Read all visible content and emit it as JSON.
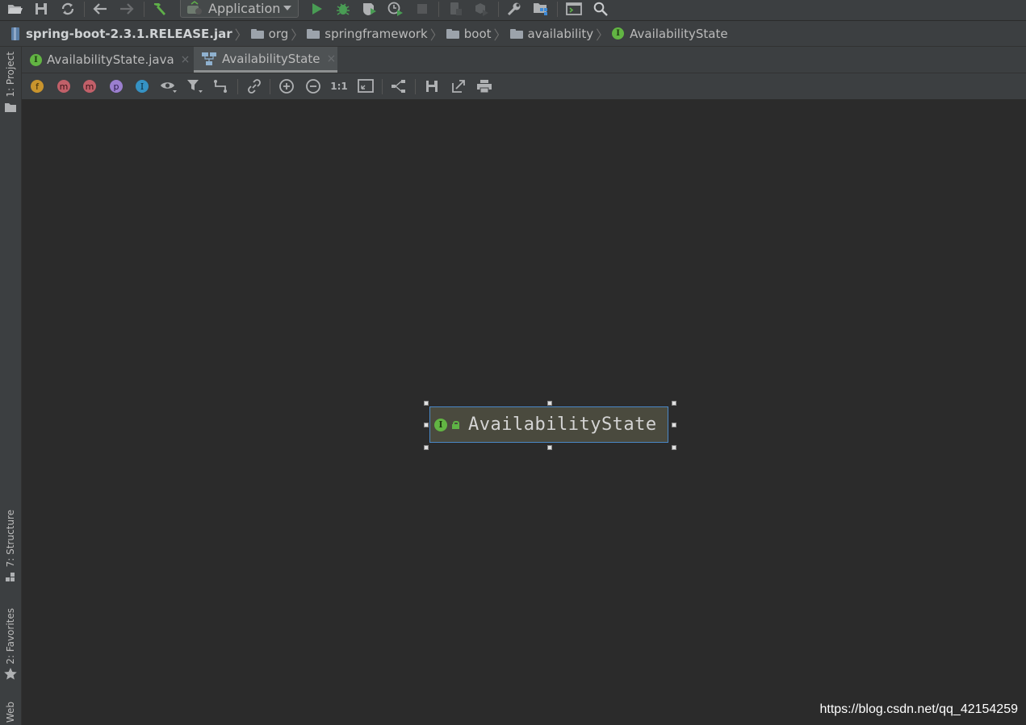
{
  "toolbar": {
    "run_config": "Application",
    "icons": [
      "open-folder-icon",
      "save-icon",
      "sync-icon",
      "back-arrow-icon",
      "forward-arrow-icon",
      "build-hammer-icon",
      "run-icon",
      "debug-icon",
      "coverage-icon",
      "profile-icon",
      "stop-icon",
      "device-icon",
      "deploy-icon",
      "settings-wrench-icon",
      "project-structure-icon",
      "terminal-icon",
      "search-icon"
    ]
  },
  "breadcrumb": {
    "jar": "spring-boot-2.3.1.RELEASE.jar",
    "pkg1": "org",
    "pkg2": "springframework",
    "pkg3": "boot",
    "pkg4": "availability",
    "cls": "AvailabilityState",
    "iface_letter": "I"
  },
  "side_tabs": {
    "project": "1: Project",
    "structure": "7: Structure",
    "favorites": "2: Favorites",
    "web": "Web"
  },
  "tabs": [
    {
      "label": "AvailabilityState.java",
      "close": "×"
    },
    {
      "label": "AvailabilityState",
      "close": "×"
    }
  ],
  "diagram_toolbar": {
    "fields": "f",
    "constructors": "m",
    "methods": "m",
    "properties": "p",
    "inner": "I",
    "zoom_actual": "1:1"
  },
  "diagram": {
    "node_label": "AvailabilityState",
    "node_letter": "I"
  },
  "colors": {
    "accent_green": "#62b543",
    "selection_border": "#4a88c7",
    "node_fill": "#4a4a3e"
  },
  "watermark": "https://blog.csdn.net/qq_42154259"
}
